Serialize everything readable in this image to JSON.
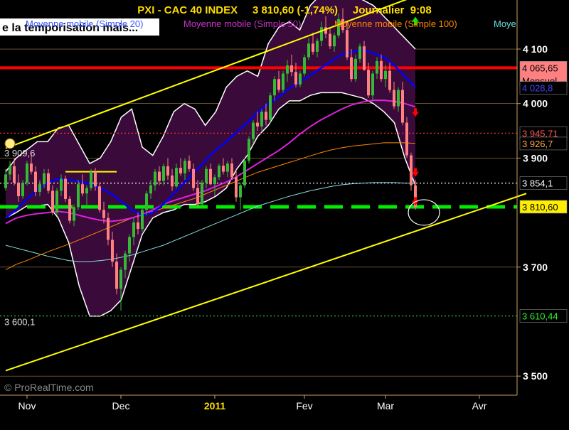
{
  "title": "PXI - CAC 40 INDEX     3 810,60 (-1,74%)     Journalier  9:08",
  "banner": "e la temporisation mais...",
  "legend": [
    {
      "text": "Moyenne mobile (Simple 20)",
      "color": "#3355ff"
    },
    {
      "text": "Moyenne mobile (Simple 50)",
      "color": "#cc33cc"
    },
    {
      "text": "Moyenne mobile (Simple 100)",
      "color": "#ff8800"
    },
    {
      "text": "Moye",
      "color": "#66dddd"
    }
  ],
  "watermark": "© ProRealTime.com",
  "colors": {
    "background": "#000000",
    "bollinger_fill": "#3a0a3a",
    "bollinger_edge": "#ffffff",
    "candle_up": "#33bb33",
    "candle_down": "#ff8080",
    "sma20": "#0000ff",
    "sma50": "#dd22dd",
    "sma100": "#ff8800",
    "sma200": "#88dddd",
    "trend": "#ffff00",
    "resistance": "#ff0000",
    "support": "#00ee00"
  },
  "chart_data": {
    "type": "candlestick",
    "x_tick_labels": [
      "Nov",
      "Dec",
      "2011",
      "Fev",
      "Mar",
      "Avr"
    ],
    "y_tick_labels": [
      {
        "value": 4100,
        "label": "4 100"
      },
      {
        "value": 4000,
        "label": "4 000"
      },
      {
        "value": 3900,
        "label": "3 900"
      },
      {
        "value": 3700,
        "label": "3 700"
      },
      {
        "value": 3500,
        "label": "3 500"
      }
    ],
    "ylim": [
      3465,
      4190
    ],
    "price_tags": [
      {
        "value": 4065.65,
        "label": "4 065,65",
        "sublabel": "Mensuel",
        "bg": "#ff8080",
        "fg": "#000000"
      },
      {
        "value": 4028.8,
        "label": "4 028,8",
        "bg": "#000000",
        "fg": "#4444ff"
      },
      {
        "value": 3945.71,
        "label": "3 945,71",
        "bg": "#000000",
        "fg": "#ff5555"
      },
      {
        "value": 3926.7,
        "label": "3 926,7",
        "bg": "#000000",
        "fg": "#ffaa44"
      },
      {
        "value": 3854.1,
        "label": "3 854,1",
        "bg": "#000000",
        "fg": "#ffffff"
      },
      {
        "value": 3810.6,
        "label": "3 810,60",
        "bg": "#ffee00",
        "fg": "#000000"
      },
      {
        "value": 3610.44,
        "label": "3 610,44",
        "bg": "#000000",
        "fg": "#33ee33"
      }
    ],
    "left_labels": [
      {
        "value": 3909.6,
        "label": "3 909,6"
      },
      {
        "value": 3600.1,
        "label": "3 600,1"
      }
    ],
    "horizontal_lines": [
      {
        "value": 4065.65,
        "color": "#ff0000",
        "style": "solid-thick"
      },
      {
        "value": 3945.71,
        "color": "#ff3333",
        "style": "dotted"
      },
      {
        "value": 3854.1,
        "color": "#ffffff",
        "style": "dotted"
      },
      {
        "value": 3810.6,
        "color": "#00ee00",
        "style": "dashed-thick"
      },
      {
        "value": 3610.44,
        "color": "#33cc33",
        "style": "dotted"
      }
    ],
    "ohlc": [
      [
        3845,
        3880,
        3840,
        3870
      ],
      [
        3870,
        3895,
        3860,
        3885
      ],
      [
        3885,
        3900,
        3850,
        3855
      ],
      [
        3855,
        3870,
        3820,
        3830
      ],
      [
        3830,
        3860,
        3825,
        3855
      ],
      [
        3855,
        3895,
        3850,
        3890
      ],
      [
        3890,
        3910,
        3870,
        3875
      ],
      [
        3875,
        3885,
        3830,
        3838
      ],
      [
        3838,
        3860,
        3830,
        3852
      ],
      [
        3852,
        3880,
        3845,
        3872
      ],
      [
        3872,
        3880,
        3835,
        3840
      ],
      [
        3840,
        3850,
        3795,
        3800
      ],
      [
        3800,
        3845,
        3795,
        3840
      ],
      [
        3840,
        3870,
        3830,
        3862
      ],
      [
        3862,
        3868,
        3820,
        3825
      ],
      [
        3825,
        3830,
        3780,
        3785
      ],
      [
        3785,
        3815,
        3775,
        3810
      ],
      [
        3810,
        3860,
        3805,
        3852
      ],
      [
        3852,
        3870,
        3830,
        3835
      ],
      [
        3835,
        3850,
        3810,
        3845
      ],
      [
        3845,
        3880,
        3840,
        3875
      ],
      [
        3875,
        3882,
        3840,
        3848
      ],
      [
        3848,
        3855,
        3800,
        3805
      ],
      [
        3805,
        3820,
        3780,
        3790
      ],
      [
        3790,
        3800,
        3740,
        3750
      ],
      [
        3750,
        3765,
        3700,
        3710
      ],
      [
        3710,
        3725,
        3650,
        3660
      ],
      [
        3660,
        3700,
        3620,
        3695
      ],
      [
        3695,
        3730,
        3680,
        3725
      ],
      [
        3725,
        3760,
        3710,
        3755
      ],
      [
        3755,
        3790,
        3740,
        3782
      ],
      [
        3782,
        3800,
        3760,
        3770
      ],
      [
        3770,
        3810,
        3765,
        3805
      ],
      [
        3805,
        3840,
        3795,
        3835
      ],
      [
        3835,
        3860,
        3825,
        3850
      ],
      [
        3850,
        3880,
        3840,
        3875
      ],
      [
        3875,
        3885,
        3850,
        3858
      ],
      [
        3858,
        3890,
        3850,
        3885
      ],
      [
        3885,
        3900,
        3860,
        3868
      ],
      [
        3868,
        3880,
        3840,
        3848
      ],
      [
        3848,
        3890,
        3845,
        3882
      ],
      [
        3882,
        3900,
        3868,
        3872
      ],
      [
        3872,
        3900,
        3860,
        3895
      ],
      [
        3895,
        3905,
        3875,
        3880
      ],
      [
        3880,
        3890,
        3840,
        3845
      ],
      [
        3845,
        3860,
        3810,
        3815
      ],
      [
        3815,
        3860,
        3810,
        3855
      ],
      [
        3855,
        3885,
        3845,
        3880
      ],
      [
        3880,
        3890,
        3850,
        3852
      ],
      [
        3852,
        3870,
        3830,
        3865
      ],
      [
        3865,
        3890,
        3860,
        3886
      ],
      [
        3886,
        3900,
        3870,
        3875
      ],
      [
        3875,
        3895,
        3865,
        3890
      ],
      [
        3890,
        3900,
        3860,
        3865
      ],
      [
        3865,
        3880,
        3820,
        3828
      ],
      [
        3828,
        3855,
        3805,
        3850
      ],
      [
        3850,
        3900,
        3845,
        3895
      ],
      [
        3895,
        3940,
        3890,
        3935
      ],
      [
        3935,
        3970,
        3925,
        3965
      ],
      [
        3965,
        3985,
        3950,
        3958
      ],
      [
        3958,
        3990,
        3950,
        3985
      ],
      [
        3985,
        4000,
        3960,
        3970
      ],
      [
        3970,
        4020,
        3965,
        4015
      ],
      [
        4015,
        4050,
        4005,
        4045
      ],
      [
        4045,
        4060,
        4020,
        4025
      ],
      [
        4025,
        4060,
        4020,
        4055
      ],
      [
        4055,
        4080,
        4040,
        4070
      ],
      [
        4070,
        4090,
        4050,
        4058
      ],
      [
        4058,
        4075,
        4030,
        4035
      ],
      [
        4035,
        4060,
        4030,
        4055
      ],
      [
        4055,
        4090,
        4050,
        4085
      ],
      [
        4085,
        4120,
        4080,
        4110
      ],
      [
        4110,
        4130,
        4090,
        4095
      ],
      [
        4095,
        4120,
        4085,
        4115
      ],
      [
        4115,
        4150,
        4105,
        4140
      ],
      [
        4140,
        4160,
        4120,
        4128
      ],
      [
        4128,
        4140,
        4100,
        4105
      ],
      [
        4105,
        4130,
        4095,
        4125
      ],
      [
        4125,
        4165,
        4120,
        4155
      ],
      [
        4155,
        4175,
        4130,
        4135
      ],
      [
        4135,
        4150,
        4080,
        4085
      ],
      [
        4085,
        4100,
        4040,
        4045
      ],
      [
        4045,
        4090,
        4040,
        4082
      ],
      [
        4082,
        4110,
        4075,
        4105
      ],
      [
        4105,
        4115,
        4060,
        4062
      ],
      [
        4062,
        4075,
        4010,
        4015
      ],
      [
        4015,
        4060,
        4005,
        4055
      ],
      [
        4055,
        4085,
        4045,
        4078
      ],
      [
        4078,
        4090,
        4040,
        4045
      ],
      [
        4045,
        4070,
        4030,
        4060
      ],
      [
        4060,
        4075,
        4020,
        4025
      ],
      [
        4025,
        4040,
        3990,
        3995
      ],
      [
        3995,
        4030,
        3985,
        4025
      ],
      [
        4025,
        4040,
        3960,
        3965
      ],
      [
        3965,
        3975,
        3900,
        3905
      ],
      [
        3905,
        3910,
        3840,
        3850
      ],
      [
        3850,
        3860,
        3805,
        3810
      ]
    ],
    "sma20": [
      3790,
      3805,
      3825,
      3842,
      3855,
      3862,
      3860,
      3858,
      3852,
      3845,
      3835,
      3820,
      3805,
      3795,
      3800,
      3815,
      3835,
      3855,
      3875,
      3895,
      3915,
      3930,
      3948,
      3965,
      3985,
      4000,
      4012,
      4028,
      4040,
      4052,
      4065,
      4078,
      4090,
      4095,
      4098,
      4092,
      4085,
      4070,
      4050,
      4030
    ],
    "sma50": [
      3780,
      3790,
      3795,
      3798,
      3800,
      3802,
      3800,
      3795,
      3790,
      3786,
      3784,
      3786,
      3790,
      3796,
      3805,
      3815,
      3822,
      3828,
      3834,
      3840,
      3848,
      3856,
      3866,
      3878,
      3890,
      3902,
      3914,
      3928,
      3944,
      3958,
      3970,
      3980,
      3990,
      3998,
      4003,
      4006,
      4006,
      4004,
      4000,
      3994
    ],
    "sma100": [
      3695,
      3705,
      3712,
      3720,
      3728,
      3735,
      3742,
      3750,
      3758,
      3766,
      3774,
      3782,
      3790,
      3796,
      3802,
      3808,
      3814,
      3820,
      3826,
      3834,
      3842,
      3850,
      3858,
      3866,
      3874,
      3880,
      3886,
      3892,
      3898,
      3904,
      3910,
      3915,
      3919,
      3922,
      3924,
      3926,
      3928,
      3928,
      3928,
      3927
    ],
    "sma200": [
      3740,
      3735,
      3730,
      3725,
      3720,
      3716,
      3712,
      3710,
      3710,
      3712,
      3714,
      3718,
      3722,
      3728,
      3734,
      3740,
      3748,
      3756,
      3764,
      3772,
      3780,
      3788,
      3796,
      3804,
      3812,
      3818,
      3824,
      3830,
      3835,
      3840,
      3844,
      3848,
      3851,
      3853,
      3854,
      3855,
      3855,
      3855,
      3854,
      3854
    ],
    "bollinger_upper": [
      3875,
      3900,
      3915,
      3930,
      3930,
      3955,
      3960,
      3925,
      3890,
      3900,
      3930,
      3975,
      3990,
      3920,
      3905,
      3940,
      3985,
      4000,
      3990,
      3960,
      3985,
      4030,
      4050,
      4060,
      4050,
      4110,
      4140,
      4150,
      4135,
      4180,
      4200,
      4200,
      4200,
      4200,
      4190,
      4180,
      4160,
      4140,
      4120,
      4100
    ],
    "bollinger_lower": [
      3790,
      3800,
      3812,
      3812,
      3815,
      3790,
      3745,
      3665,
      3610,
      3610,
      3620,
      3640,
      3700,
      3760,
      3790,
      3800,
      3805,
      3815,
      3815,
      3820,
      3830,
      3845,
      3880,
      3905,
      3940,
      3960,
      3990,
      4005,
      4005,
      4015,
      4020,
      4020,
      4020,
      4015,
      4010,
      4000,
      3985,
      3965,
      3900,
      3850
    ],
    "trend_lines": [
      {
        "from": [
          0,
          3918
        ],
        "to": [
          97,
          4200
        ],
        "color": "#ffff00"
      },
      {
        "from": [
          0,
          3510
        ],
        "to": [
          122,
          3835
        ],
        "color": "#ffff00"
      }
    ],
    "short_horizontal": {
      "value": 3875,
      "from_index": 14,
      "to_index": 26,
      "color": "#ffff00"
    },
    "arrows": [
      {
        "index": 96,
        "value": 4150,
        "direction": "up",
        "color": "#00ee00"
      },
      {
        "index": 96,
        "value": 3985,
        "direction": "down",
        "color": "#ff0000"
      },
      {
        "index": 96,
        "value": 3875,
        "direction": "down",
        "color": "#ff0000"
      },
      {
        "index": 96,
        "value": 3822,
        "direction": "down",
        "color": "#ff0000"
      }
    ],
    "circle_marker": {
      "index": 97,
      "value": 3808
    }
  }
}
